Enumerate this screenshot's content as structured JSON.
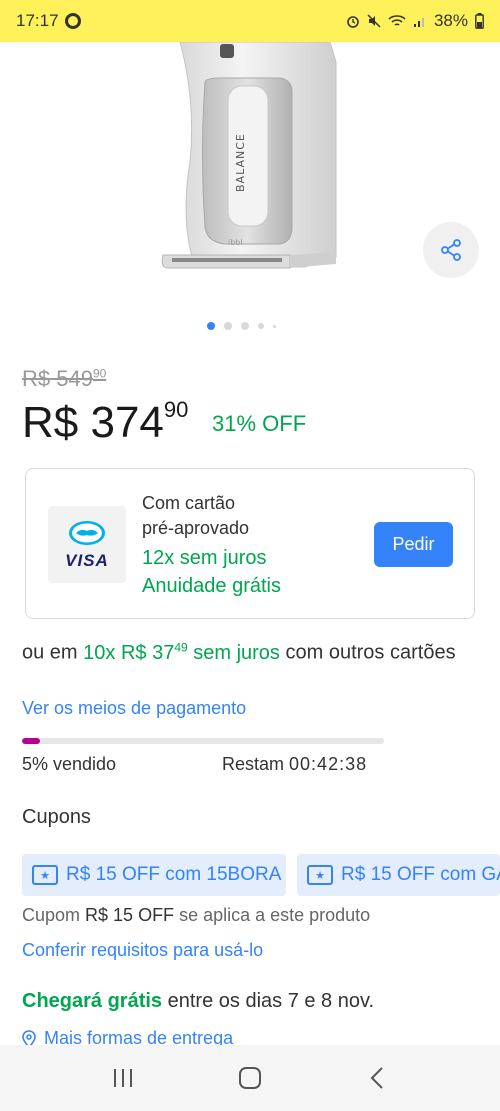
{
  "status_bar": {
    "time": "17:17",
    "battery": "38%"
  },
  "carousel": {
    "total_images": 5,
    "active_index": 0
  },
  "product": {
    "brand_label": "BALANCE",
    "small_logo_text": "ibbl"
  },
  "pricing": {
    "old_price": "R$ 549",
    "old_price_cents": "90",
    "price": "R$ 374",
    "price_cents": "90",
    "discount": "31% OFF"
  },
  "card_offer": {
    "line1": "Com cartão",
    "line2": "pré-aprovado",
    "line3": "12x sem juros",
    "line4": "Anuidade grátis",
    "card_brand": "VISA",
    "button_label": "Pedir"
  },
  "installments": {
    "prefix": "ou em ",
    "amount": "10x R$ 37",
    "amount_cents": "49",
    "interest": " sem juros",
    "suffix": " com outros cartões"
  },
  "payment_methods_link": "Ver os meios de pagamento",
  "sales": {
    "progress_percent": 5,
    "sold_text": "5% vendido",
    "remaining_label": "Restam ",
    "timer": "00:42:38"
  },
  "coupons": {
    "title": "Cupons",
    "items": [
      {
        "label": "R$ 15 OFF com 15BORA"
      },
      {
        "label": "R$ 15 OFF com GA"
      }
    ],
    "info_prefix": "Cupom ",
    "info_value": "R$ 15 OFF",
    "info_suffix": " se aplica a este produto",
    "requirements_link": "Conferir requisitos para usá-lo"
  },
  "shipping": {
    "highlight": "Chegará grátis",
    "text": " entre os dias 7 e 8 nov.",
    "more_link": "Mais formas de entrega"
  },
  "colors": {
    "brand_yellow": "#fff159",
    "accent_blue": "#3483fa",
    "success_green": "#00a650",
    "progress_magenta": "#b5008f"
  }
}
